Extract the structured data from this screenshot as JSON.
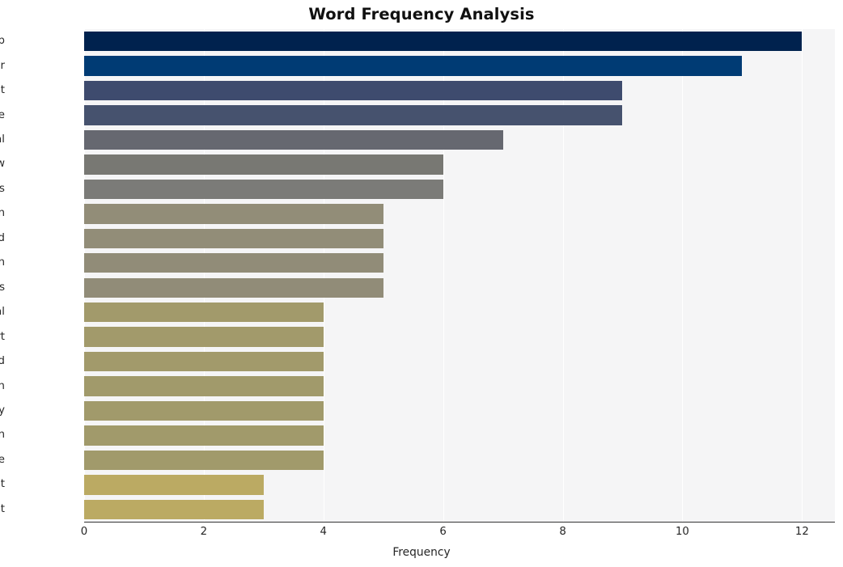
{
  "chart_data": {
    "type": "bar",
    "orientation": "horizontal",
    "title": "Word Frequency Analysis",
    "xlabel": "Frequency",
    "ylabel": "",
    "categories": [
      "citizenship",
      "bear",
      "government",
      "rule",
      "federal",
      "law",
      "canadians",
      "children",
      "abroad",
      "canadian",
      "citizens",
      "appeal",
      "court",
      "second",
      "generation",
      "choudhry",
      "foreign",
      "create",
      "act",
      "cut"
    ],
    "values": [
      12,
      11,
      9,
      9,
      7,
      6,
      6,
      5,
      5,
      5,
      5,
      4,
      4,
      4,
      4,
      4,
      4,
      4,
      3,
      3
    ],
    "bar_colors": [
      "#00224e",
      "#003b74",
      "#3e4b6e",
      "#46526e",
      "#666870",
      "#787873",
      "#7b7b78",
      "#928d78",
      "#928d78",
      "#918c78",
      "#918c78",
      "#a29a6b",
      "#a29a6b",
      "#a29a6b",
      "#a19a6b",
      "#a19a6b",
      "#a19a6b",
      "#a19a6b",
      "#bbaa63",
      "#bbaa63"
    ],
    "xlim": [
      0,
      12.55
    ],
    "xticks": [
      0,
      2,
      4,
      6,
      8,
      10,
      12
    ],
    "xtick_labels": [
      "0",
      "2",
      "4",
      "6",
      "8",
      "10",
      "12"
    ],
    "grid": true,
    "grid_axis": "x",
    "grid_color": "#ffffff",
    "plot_background": "#f5f5f6",
    "figure_background": "#ffffff",
    "legend": null,
    "colormap": "cividis"
  }
}
